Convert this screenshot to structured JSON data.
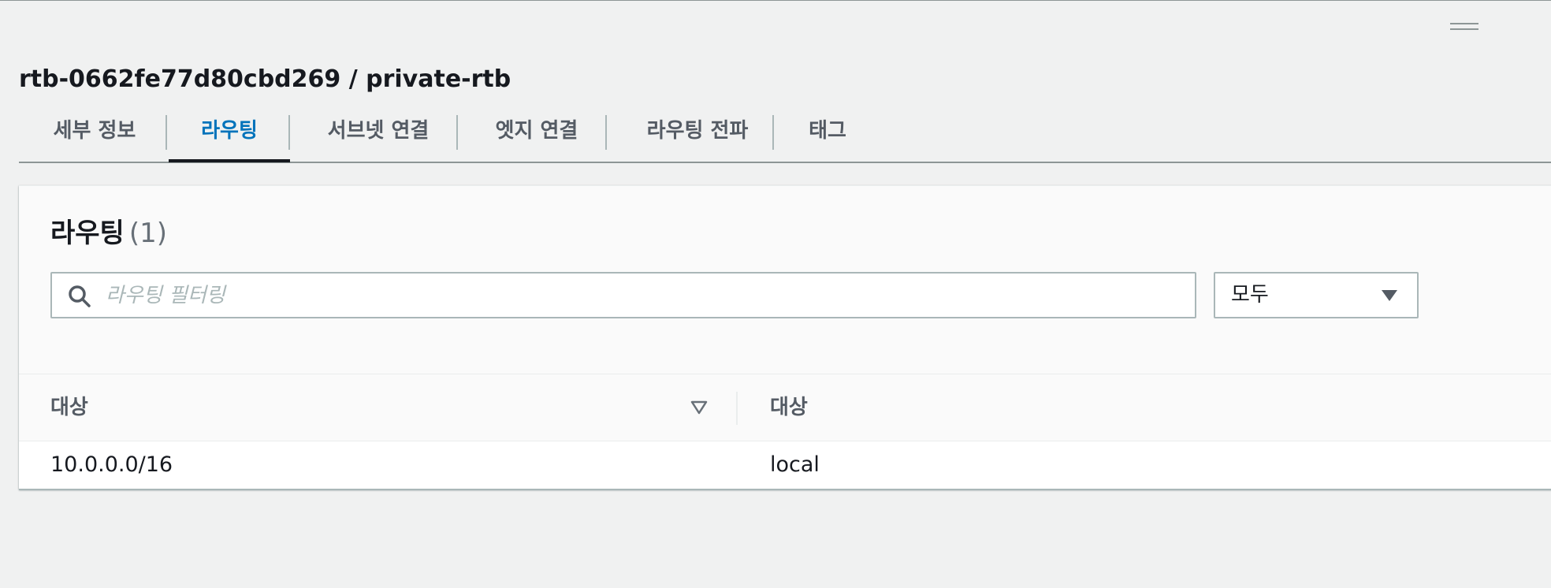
{
  "header": {
    "title": "rtb-0662fe77d80cbd269 / private-rtb"
  },
  "tabs": [
    {
      "label": "세부 정보",
      "active": false
    },
    {
      "label": "라우팅",
      "active": true
    },
    {
      "label": "서브넷 연결",
      "active": false
    },
    {
      "label": "엣지 연결",
      "active": false
    },
    {
      "label": "라우팅 전파",
      "active": false
    },
    {
      "label": "태그",
      "active": false
    }
  ],
  "routes": {
    "title": "라우팅",
    "count": "(1)",
    "search": {
      "placeholder": "라우팅 필터링",
      "icon": "search-icon"
    },
    "filter_select": {
      "value": "모두",
      "icon": "caret-down-icon"
    },
    "table": {
      "columns": [
        "대상",
        "대상"
      ],
      "sort_icon": "sort-descending-icon",
      "rows": [
        {
          "destination": "10.0.0.0/16",
          "target": "local"
        }
      ]
    }
  },
  "colors": {
    "accent": "#0073bb",
    "text": "#16191f",
    "muted": "#545b64",
    "border": "#aab7b8",
    "background": "#f0f1f1"
  }
}
